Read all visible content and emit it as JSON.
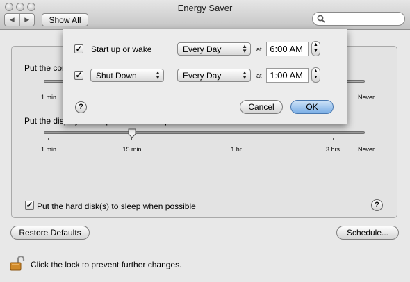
{
  "window": {
    "title": "Energy Saver"
  },
  "toolbar": {
    "back_label": "◀",
    "forward_label": "▶",
    "show_all_label": "Show All",
    "search_placeholder": ""
  },
  "main": {
    "computer_sleep_label": "Put the computer to sleep when it is inactive for:",
    "display_sleep_label": "Put the display to sleep when the computer is inactive for:",
    "slider_ticks": {
      "min1": "1 min",
      "min15": "15 min",
      "hr1": "1 hr",
      "hrs3": "3 hrs",
      "never": "Never"
    },
    "display_slider_value": "15 min",
    "harddisk_checkbox_label": "Put the hard disk(s) to sleep when possible",
    "harddisk_checked": true,
    "help_label": "?"
  },
  "footer": {
    "restore_defaults_label": "Restore Defaults",
    "schedule_label": "Schedule...",
    "lock_text": "Click the lock to prevent further changes."
  },
  "sheet": {
    "row1": {
      "checked": true,
      "label": "Start up or wake",
      "day": "Every Day",
      "at": "at",
      "time": "6:00 AM"
    },
    "row2": {
      "checked": true,
      "action": "Shut Down",
      "day": "Every Day",
      "at": "at",
      "time": "1:00 AM"
    },
    "help_label": "?",
    "cancel_label": "Cancel",
    "ok_label": "OK"
  },
  "colors": {
    "window_bg": "#e8e8e8",
    "ok_accent": "#9ec3ea"
  }
}
